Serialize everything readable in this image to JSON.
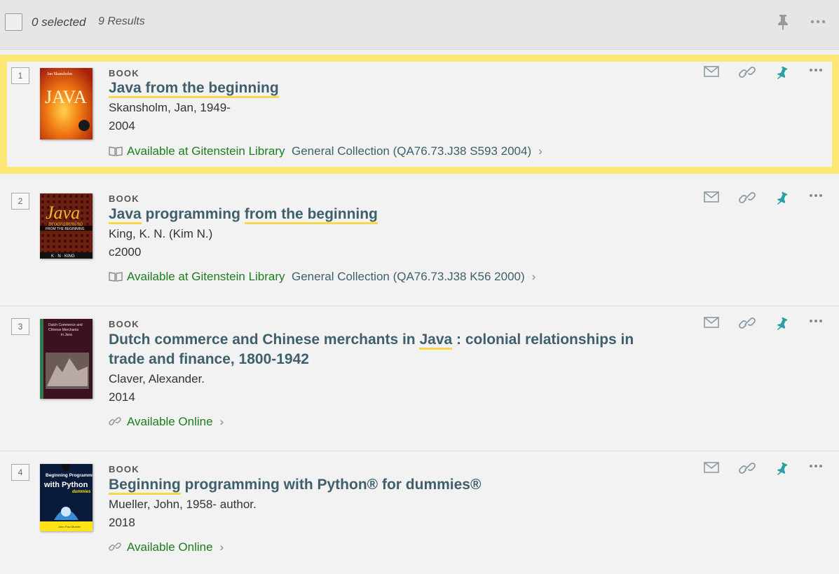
{
  "toolbar": {
    "selected": "0 selected",
    "results": "9 Results",
    "icons": [
      "checkbox",
      "pin-icon",
      "more-icon"
    ]
  },
  "colors": {
    "highlight_border": "#fde876",
    "title": "#3e5f6b",
    "available": "#1d7d1d",
    "pin": "#2a9fa6",
    "underline": "#f7d84a"
  },
  "results": [
    {
      "number": "1",
      "type": "BOOK",
      "title": "Java from the beginning",
      "author": "Skansholm, Jan, 1949-",
      "date": "2004",
      "availability": "Available at Gitenstein Library",
      "location": "General Collection (QA76.73.J38 S593 2004)",
      "cover_text": "JAVA",
      "cover_author": "Jan Skansholm",
      "selected": true
    },
    {
      "number": "2",
      "type": "BOOK",
      "title": "Java programming from the beginning",
      "author": "King, K. N. (Kim N.)",
      "date": "c2000",
      "availability": "Available at Gitenstein Library",
      "location": "General Collection (QA76.73.J38 K56 2000)",
      "cover_text": "Java",
      "cover_sub": "programming",
      "cover_band": "FROM THE BEGINNING",
      "cover_author": "K · N · KING"
    },
    {
      "number": "3",
      "type": "BOOK",
      "title": "Dutch commerce and Chinese merchants in Java : colonial relationships in trade and finance, 1800-1942",
      "author": "Claver, Alexander.",
      "date": "2014",
      "availability": "Available Online",
      "cover_text": "Dutch Commerce and Chinese Merchants in Java"
    },
    {
      "number": "4",
      "type": "BOOK",
      "title": "Beginning programming with Python® for dummies®",
      "author": "Mueller, John, 1958- author.",
      "date": "2018",
      "availability": "Available Online",
      "cover_text": "Beginning Programming with Python",
      "cover_brand": "dummies"
    }
  ]
}
